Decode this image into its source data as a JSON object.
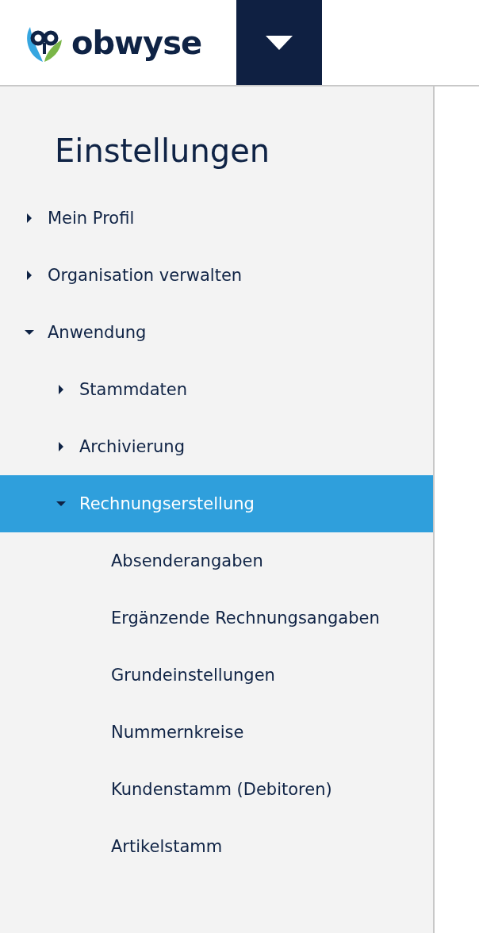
{
  "header": {
    "logo_text": "obwyse"
  },
  "sidebar": {
    "title": "Einstellungen",
    "items": [
      {
        "label": "Mein Profil",
        "expanded": false,
        "selected": false
      },
      {
        "label": "Organisation verwalten",
        "expanded": false,
        "selected": false
      },
      {
        "label": "Anwendung",
        "expanded": true,
        "selected": false,
        "children": [
          {
            "label": "Stammdaten",
            "expanded": false,
            "selected": false
          },
          {
            "label": "Archivierung",
            "expanded": false,
            "selected": false
          },
          {
            "label": "Rechnungserstellung",
            "expanded": true,
            "selected": true,
            "children": [
              {
                "label": "Absenderangaben",
                "selected": false
              },
              {
                "label": "Ergänzende Rechnungsangaben",
                "selected": false
              },
              {
                "label": "Grundeinstellungen",
                "selected": false
              },
              {
                "label": "Nummernkreise",
                "selected": false
              },
              {
                "label": "Kundenstamm (Debitoren)",
                "selected": false
              },
              {
                "label": "Artikelstamm",
                "selected": false
              }
            ]
          }
        ]
      }
    ]
  }
}
